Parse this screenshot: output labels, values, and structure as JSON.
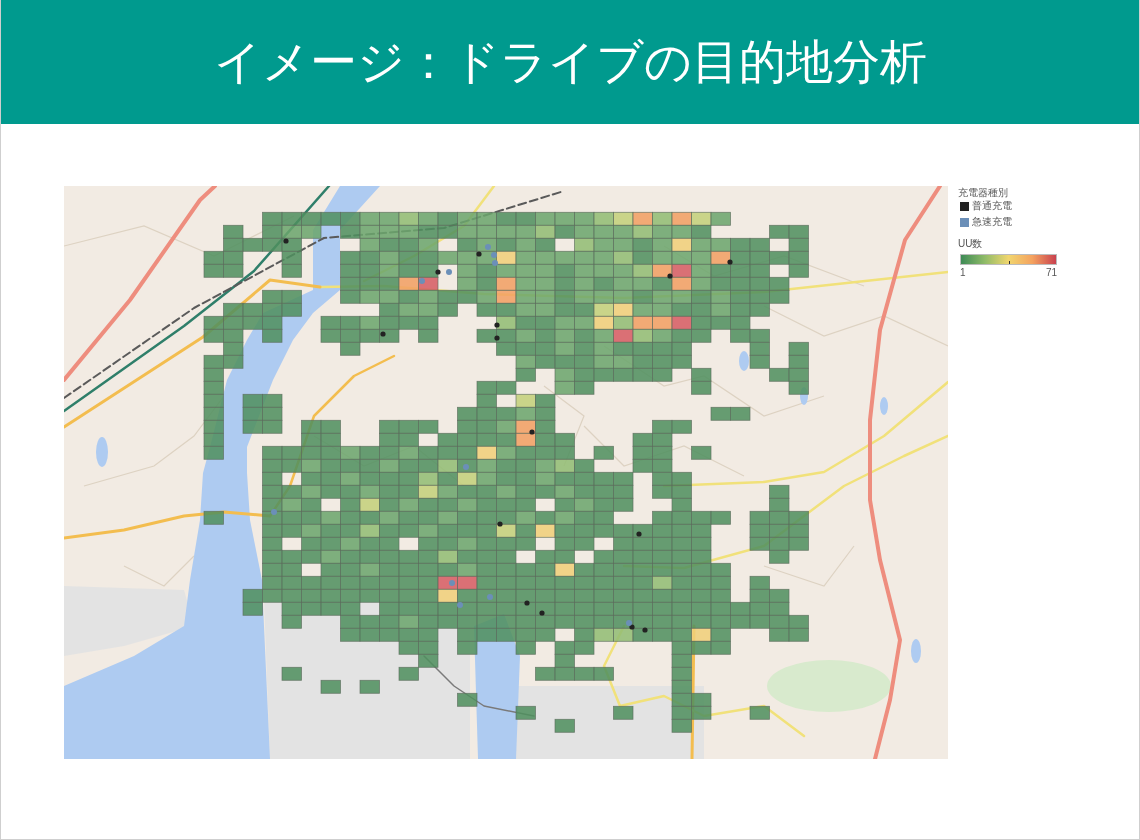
{
  "header": {
    "title": "イメージ：ドライブの目的地分析"
  },
  "map": {
    "legend": {
      "title": "充電器種別",
      "items": [
        {
          "label": "普通充電",
          "color": "#222222"
        },
        {
          "label": "急速充電",
          "color": "#6b8fb8"
        }
      ]
    },
    "color_scale": {
      "title": "UU数",
      "min_label": "1",
      "max_label": "71"
    }
  }
}
